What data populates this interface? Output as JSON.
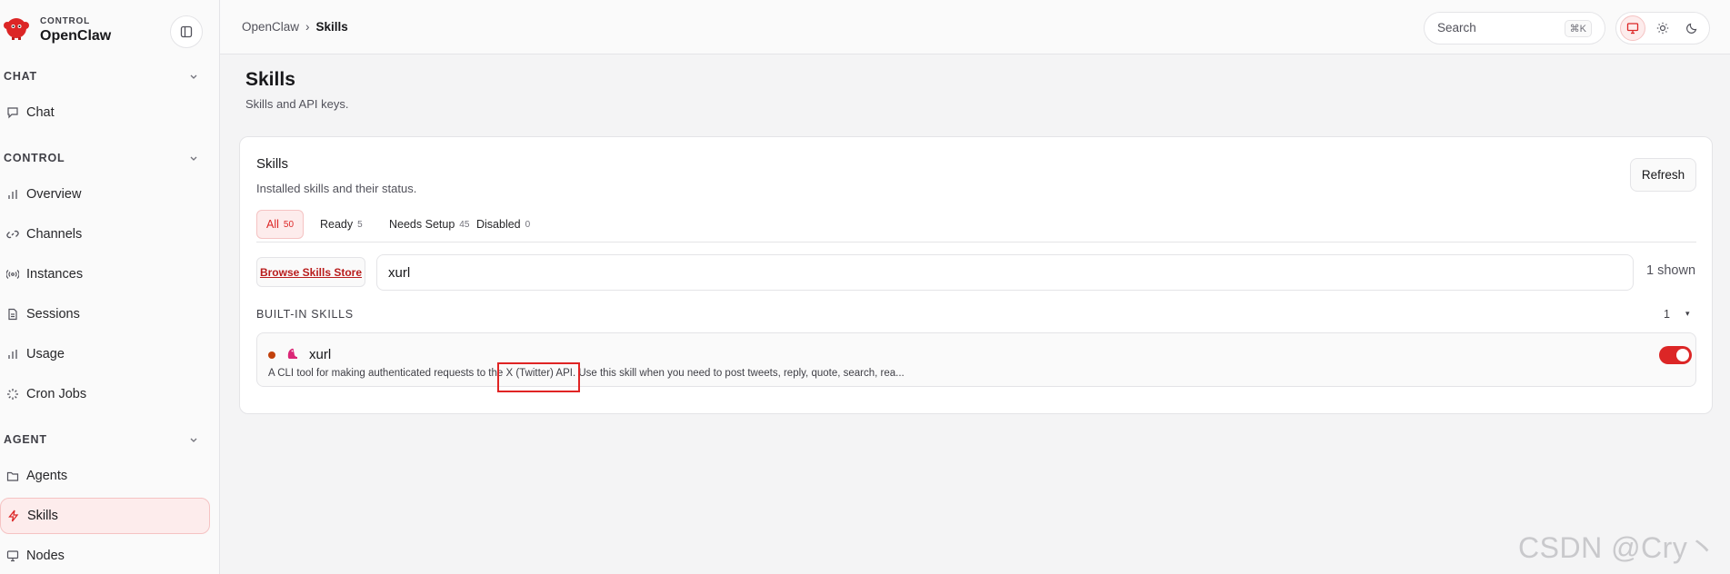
{
  "brand": {
    "small": "CONTROL",
    "title": "OpenClaw"
  },
  "sidebar": {
    "sections": [
      {
        "label": "CHAT",
        "items": [
          {
            "label": "Chat",
            "icon": "message-icon"
          }
        ]
      },
      {
        "label": "CONTROL",
        "items": [
          {
            "label": "Overview",
            "icon": "bar-chart-icon"
          },
          {
            "label": "Channels",
            "icon": "link-icon"
          },
          {
            "label": "Instances",
            "icon": "radio-icon"
          },
          {
            "label": "Sessions",
            "icon": "document-icon"
          },
          {
            "label": "Usage",
            "icon": "bar-chart-icon"
          },
          {
            "label": "Cron Jobs",
            "icon": "loader-icon"
          }
        ]
      },
      {
        "label": "AGENT",
        "items": [
          {
            "label": "Agents",
            "icon": "folder-icon"
          },
          {
            "label": "Skills",
            "icon": "zap-icon",
            "active": true
          },
          {
            "label": "Nodes",
            "icon": "monitor-icon"
          }
        ]
      }
    ]
  },
  "topbar": {
    "breadcrumb": {
      "root": "OpenClaw",
      "separator": "›",
      "current": "Skills"
    },
    "search": {
      "placeholder": "Search",
      "shortcut": "⌘K"
    }
  },
  "page": {
    "title": "Skills",
    "subtitle": "Skills and API keys."
  },
  "card": {
    "title": "Skills",
    "subtitle": "Installed skills and their status.",
    "refresh_label": "Refresh",
    "tabs": [
      {
        "label": "All",
        "count": "50",
        "active": true
      },
      {
        "label": "Ready",
        "count": "5"
      },
      {
        "label": "Needs Setup",
        "count": "45"
      },
      {
        "label": "Disabled",
        "count": "0"
      }
    ],
    "store_label": "Browse Skills Store",
    "filter_value": "xurl",
    "shown_label": "1 shown",
    "group": {
      "label": "BUILT-IN SKILLS",
      "count": "1",
      "caret": "▾",
      "skills": [
        {
          "name": "xurl",
          "description": "A CLI tool for making authenticated requests to the X (Twitter) API. Use this skill when you need to post tweets, reply, quote, search, rea...",
          "enabled": true
        }
      ]
    }
  },
  "colors": {
    "accent": "#dc2626",
    "accent_soft": "#fdecec",
    "status_needs_setup": "#c2410c"
  },
  "watermark": "CSDN @Cry丶"
}
